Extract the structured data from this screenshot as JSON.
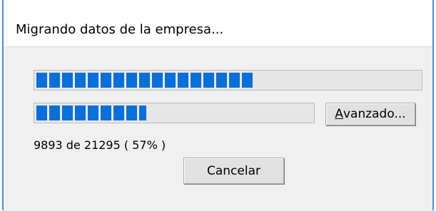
{
  "dialog": {
    "title": "Migrando datos de la empresa..."
  },
  "progress": {
    "overall_fraction": 0.57,
    "step_fraction": 0.4,
    "status_text": "9893 de 21295 ( 57% )"
  },
  "buttons": {
    "advanced_label_mnemonic": "A",
    "advanced_label_rest": "vanzado...",
    "cancel_label": "Cancelar"
  }
}
